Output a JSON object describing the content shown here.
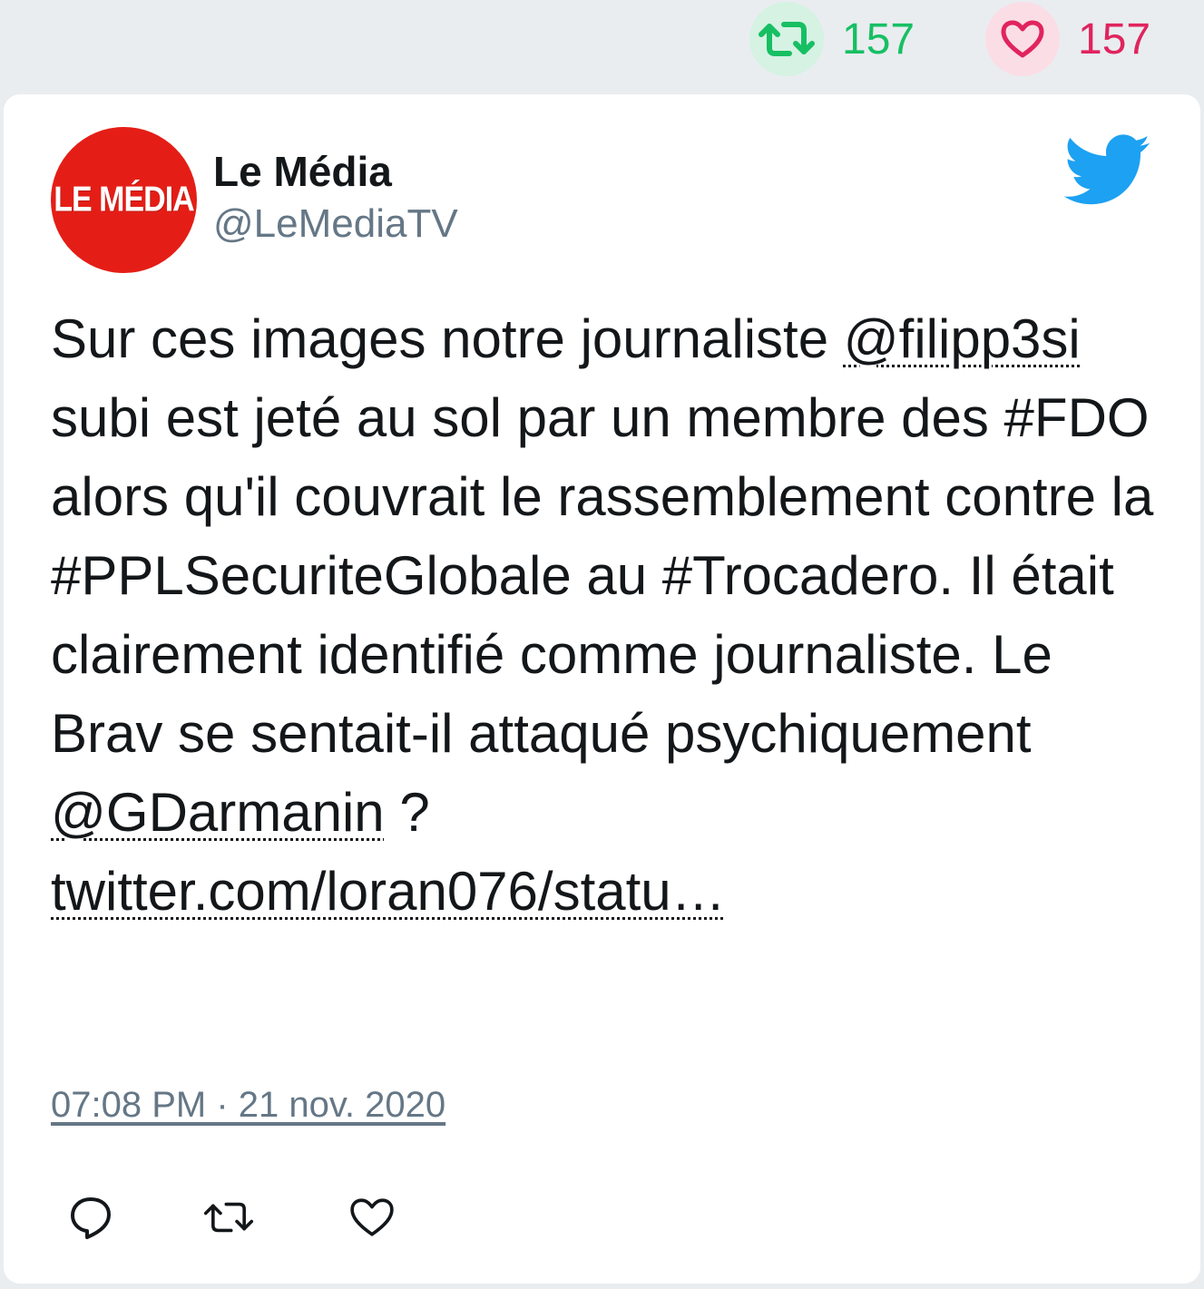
{
  "stats": {
    "retweet_count": "157",
    "like_count": "157"
  },
  "colors": {
    "retweet": "#17bf63",
    "like": "#e0245e",
    "avatar_bg": "#e41e16",
    "twitter_blue": "#1da1f2"
  },
  "author": {
    "name": "Le Média",
    "handle": "@LeMediaTV",
    "avatar_text": "LE MÉDIA"
  },
  "tweet": {
    "part1": "Sur ces images notre journaliste ",
    "mention1": "@filipp3si",
    "part2": " subi est jeté au sol par un membre des #FDO alors qu'il couvrait le rassemblement contre la #PPLSecuriteGlobale au #Trocadero. Il était clairement identifié comme journaliste. Le Brav se sentait-il attaqué psychiquement ",
    "mention2": "@GDarmanin",
    "part3": " ?",
    "link": "twitter.com/loran076/statu…"
  },
  "timestamp": "07:08 PM · 21 nov. 2020",
  "icons": {
    "top_retweet": "retweet-icon",
    "top_like": "heart-icon",
    "brand": "twitter-bird-icon",
    "reply": "reply-icon",
    "retweet": "retweet-icon",
    "like": "heart-icon"
  }
}
